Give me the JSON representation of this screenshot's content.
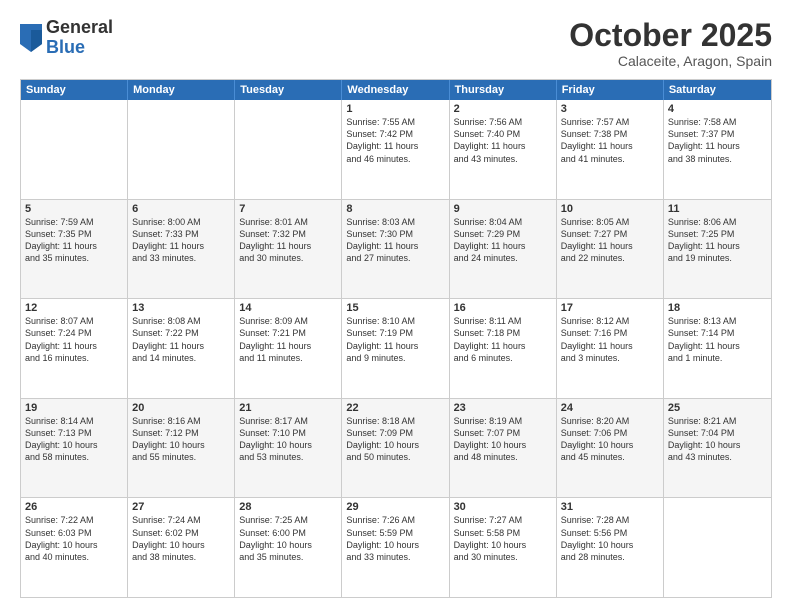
{
  "header": {
    "logo": {
      "general": "General",
      "blue": "Blue"
    },
    "title": "October 2025",
    "location": "Calaceite, Aragon, Spain"
  },
  "weekdays": [
    "Sunday",
    "Monday",
    "Tuesday",
    "Wednesday",
    "Thursday",
    "Friday",
    "Saturday"
  ],
  "rows": [
    {
      "alt": false,
      "cells": [
        {
          "day": "",
          "text": ""
        },
        {
          "day": "",
          "text": ""
        },
        {
          "day": "",
          "text": ""
        },
        {
          "day": "1",
          "text": "Sunrise: 7:55 AM\nSunset: 7:42 PM\nDaylight: 11 hours\nand 46 minutes."
        },
        {
          "day": "2",
          "text": "Sunrise: 7:56 AM\nSunset: 7:40 PM\nDaylight: 11 hours\nand 43 minutes."
        },
        {
          "day": "3",
          "text": "Sunrise: 7:57 AM\nSunset: 7:38 PM\nDaylight: 11 hours\nand 41 minutes."
        },
        {
          "day": "4",
          "text": "Sunrise: 7:58 AM\nSunset: 7:37 PM\nDaylight: 11 hours\nand 38 minutes."
        }
      ]
    },
    {
      "alt": true,
      "cells": [
        {
          "day": "5",
          "text": "Sunrise: 7:59 AM\nSunset: 7:35 PM\nDaylight: 11 hours\nand 35 minutes."
        },
        {
          "day": "6",
          "text": "Sunrise: 8:00 AM\nSunset: 7:33 PM\nDaylight: 11 hours\nand 33 minutes."
        },
        {
          "day": "7",
          "text": "Sunrise: 8:01 AM\nSunset: 7:32 PM\nDaylight: 11 hours\nand 30 minutes."
        },
        {
          "day": "8",
          "text": "Sunrise: 8:03 AM\nSunset: 7:30 PM\nDaylight: 11 hours\nand 27 minutes."
        },
        {
          "day": "9",
          "text": "Sunrise: 8:04 AM\nSunset: 7:29 PM\nDaylight: 11 hours\nand 24 minutes."
        },
        {
          "day": "10",
          "text": "Sunrise: 8:05 AM\nSunset: 7:27 PM\nDaylight: 11 hours\nand 22 minutes."
        },
        {
          "day": "11",
          "text": "Sunrise: 8:06 AM\nSunset: 7:25 PM\nDaylight: 11 hours\nand 19 minutes."
        }
      ]
    },
    {
      "alt": false,
      "cells": [
        {
          "day": "12",
          "text": "Sunrise: 8:07 AM\nSunset: 7:24 PM\nDaylight: 11 hours\nand 16 minutes."
        },
        {
          "day": "13",
          "text": "Sunrise: 8:08 AM\nSunset: 7:22 PM\nDaylight: 11 hours\nand 14 minutes."
        },
        {
          "day": "14",
          "text": "Sunrise: 8:09 AM\nSunset: 7:21 PM\nDaylight: 11 hours\nand 11 minutes."
        },
        {
          "day": "15",
          "text": "Sunrise: 8:10 AM\nSunset: 7:19 PM\nDaylight: 11 hours\nand 9 minutes."
        },
        {
          "day": "16",
          "text": "Sunrise: 8:11 AM\nSunset: 7:18 PM\nDaylight: 11 hours\nand 6 minutes."
        },
        {
          "day": "17",
          "text": "Sunrise: 8:12 AM\nSunset: 7:16 PM\nDaylight: 11 hours\nand 3 minutes."
        },
        {
          "day": "18",
          "text": "Sunrise: 8:13 AM\nSunset: 7:14 PM\nDaylight: 11 hours\nand 1 minute."
        }
      ]
    },
    {
      "alt": true,
      "cells": [
        {
          "day": "19",
          "text": "Sunrise: 8:14 AM\nSunset: 7:13 PM\nDaylight: 10 hours\nand 58 minutes."
        },
        {
          "day": "20",
          "text": "Sunrise: 8:16 AM\nSunset: 7:12 PM\nDaylight: 10 hours\nand 55 minutes."
        },
        {
          "day": "21",
          "text": "Sunrise: 8:17 AM\nSunset: 7:10 PM\nDaylight: 10 hours\nand 53 minutes."
        },
        {
          "day": "22",
          "text": "Sunrise: 8:18 AM\nSunset: 7:09 PM\nDaylight: 10 hours\nand 50 minutes."
        },
        {
          "day": "23",
          "text": "Sunrise: 8:19 AM\nSunset: 7:07 PM\nDaylight: 10 hours\nand 48 minutes."
        },
        {
          "day": "24",
          "text": "Sunrise: 8:20 AM\nSunset: 7:06 PM\nDaylight: 10 hours\nand 45 minutes."
        },
        {
          "day": "25",
          "text": "Sunrise: 8:21 AM\nSunset: 7:04 PM\nDaylight: 10 hours\nand 43 minutes."
        }
      ]
    },
    {
      "alt": false,
      "cells": [
        {
          "day": "26",
          "text": "Sunrise: 7:22 AM\nSunset: 6:03 PM\nDaylight: 10 hours\nand 40 minutes."
        },
        {
          "day": "27",
          "text": "Sunrise: 7:24 AM\nSunset: 6:02 PM\nDaylight: 10 hours\nand 38 minutes."
        },
        {
          "day": "28",
          "text": "Sunrise: 7:25 AM\nSunset: 6:00 PM\nDaylight: 10 hours\nand 35 minutes."
        },
        {
          "day": "29",
          "text": "Sunrise: 7:26 AM\nSunset: 5:59 PM\nDaylight: 10 hours\nand 33 minutes."
        },
        {
          "day": "30",
          "text": "Sunrise: 7:27 AM\nSunset: 5:58 PM\nDaylight: 10 hours\nand 30 minutes."
        },
        {
          "day": "31",
          "text": "Sunrise: 7:28 AM\nSunset: 5:56 PM\nDaylight: 10 hours\nand 28 minutes."
        },
        {
          "day": "",
          "text": ""
        }
      ]
    }
  ]
}
